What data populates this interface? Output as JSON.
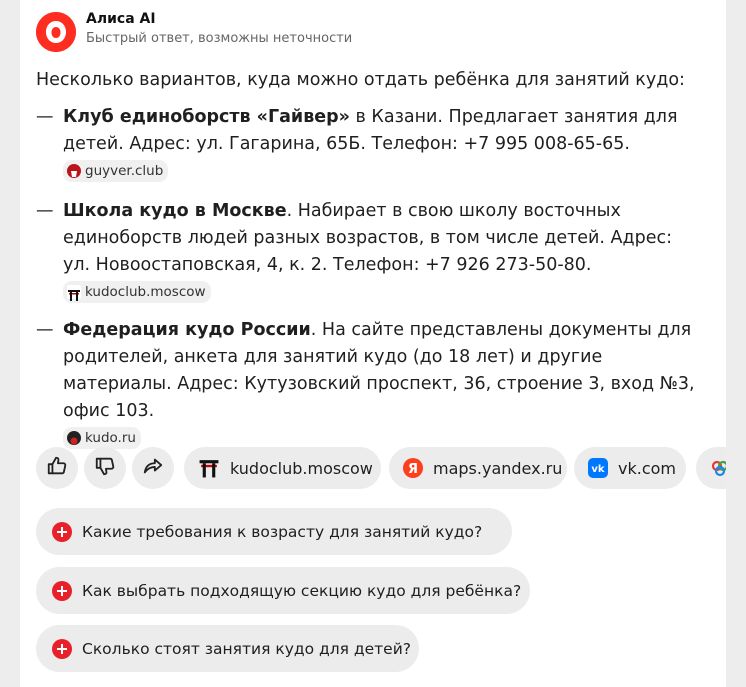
{
  "app": {
    "name": "Алиса AI",
    "subtitle": "Быстрый ответ, возможны неточности"
  },
  "answer": {
    "intro": "Несколько вариантов, куда можно отдать ребёнка для занятий кудо:",
    "items": [
      {
        "title": "Клуб единоборств «Гайвер»",
        "text": " в Казани. Предлагает занятия для детей. Адрес: ул. Гагарина, 65Б. Телефон: +7 995 008-65-65.",
        "source": "guyver.club",
        "source_icon": "guyver-logo-icon"
      },
      {
        "title": "Школа кудо в Москве",
        "text": ". Набирает в свою школу восточных единоборств людей разных возрастов, в том числе детей. Адрес: ул. Новоостаповская, 4, к. 2. Телефон: +7 926 273-50-80.",
        "source": "kudoclub.moscow",
        "source_icon": "torii-icon"
      },
      {
        "title": "Федерация кудо России",
        "text": ". На сайте представлены документы для родителей, анкета для занятий кудо (до 18 лет) и другие материалы. Адрес: Кутузовский проспект, 36, строение 3, вход №3, офис 103.",
        "source": "kudo.ru",
        "source_icon": "kudo-logo-icon"
      }
    ]
  },
  "actions": {
    "like": "thumbs-up-icon",
    "dislike": "thumbs-down-icon",
    "share": "share-arrow-icon",
    "sources": [
      {
        "label": "kudoclub.moscow",
        "icon": "torii-icon"
      },
      {
        "label": "maps.yandex.ru",
        "icon": "yandex-icon"
      },
      {
        "label": "vk.com",
        "icon": "vk-icon"
      }
    ]
  },
  "suggestions": [
    "Какие требования к возрасту для занятий кудо?",
    "Как выбрать подходящую секцию кудо для ребёнка?",
    "Сколько стоят занятия кудо для детей?"
  ],
  "colors": {
    "brand": "#ff3b30",
    "plus": "#e8202a",
    "vk": "#0077ff",
    "chip": "#ececec"
  }
}
